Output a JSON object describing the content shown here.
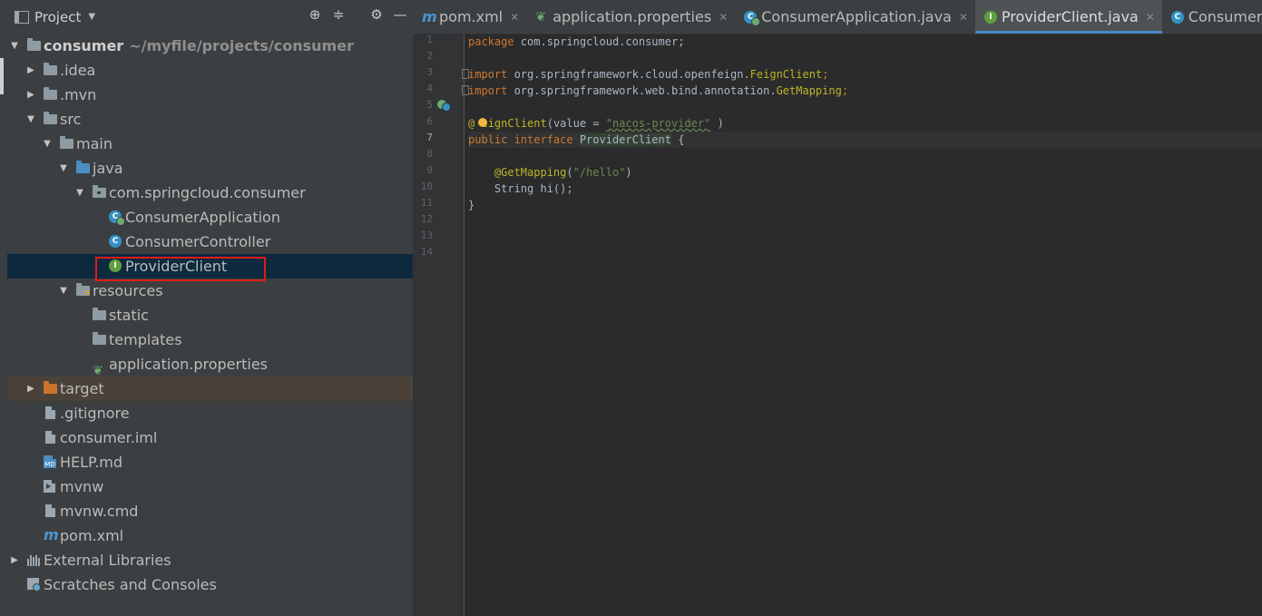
{
  "project_panel": {
    "title": "Project",
    "tree": [
      {
        "id": "root",
        "label": "consumer",
        "path": "~/myfile/projects/consumer"
      },
      {
        "id": "idea",
        "label": ".idea"
      },
      {
        "id": "mvn",
        "label": ".mvn"
      },
      {
        "id": "src",
        "label": "src"
      },
      {
        "id": "main",
        "label": "main"
      },
      {
        "id": "java",
        "label": "java"
      },
      {
        "id": "pkg",
        "label": "com.springcloud.consumer"
      },
      {
        "id": "consumer_app",
        "label": "ConsumerApplication"
      },
      {
        "id": "consumer_ctrl",
        "label": "ConsumerController"
      },
      {
        "id": "provider_client",
        "label": "ProviderClient"
      },
      {
        "id": "resources",
        "label": "resources"
      },
      {
        "id": "static",
        "label": "static"
      },
      {
        "id": "templates",
        "label": "templates"
      },
      {
        "id": "app_props",
        "label": "application.properties"
      },
      {
        "id": "target",
        "label": "target"
      },
      {
        "id": "gitignore",
        "label": ".gitignore"
      },
      {
        "id": "consumer_iml",
        "label": "consumer.iml"
      },
      {
        "id": "help_md",
        "label": "HELP.md"
      },
      {
        "id": "mvnw",
        "label": "mvnw"
      },
      {
        "id": "mvnw_cmd",
        "label": "mvnw.cmd"
      },
      {
        "id": "pom",
        "label": "pom.xml"
      },
      {
        "id": "ext_libs",
        "label": "External Libraries"
      },
      {
        "id": "scratches",
        "label": "Scratches and Consoles"
      }
    ]
  },
  "editor": {
    "tabs": [
      {
        "label": "pom.xml",
        "icon": "maven-icon"
      },
      {
        "label": "application.properties",
        "icon": "spring-properties-icon"
      },
      {
        "label": "ConsumerApplication.java",
        "icon": "spring-class-icon"
      },
      {
        "label": "ProviderClient.java",
        "icon": "interface-icon",
        "active": true
      },
      {
        "label": "ConsumerController.java",
        "icon": "class-icon"
      }
    ],
    "line_numbers": [
      "1",
      "2",
      "3",
      "4",
      "5",
      "6",
      "7",
      "8",
      "9",
      "10",
      "11",
      "12",
      "13",
      "14"
    ],
    "code": {
      "l1_kw": "package",
      "l1_rest": " com.springcloud.consumer;",
      "l3_kw": "import",
      "l3_a": " org.springframework.cloud.openfeign.",
      "l3_cls": "FeignClient",
      "l3_semi": ";",
      "l4_kw": "import",
      "l4_a": " org.springframework.web.bind.annotation.",
      "l4_cls": "GetMapping",
      "l4_semi": ";",
      "l6_at": "@",
      "l6_ann_gap": "F",
      "l6_ann": "eignClient",
      "l6_a": "(value = ",
      "l6_str": "\"nacos-provider\"",
      "l6_b": " )",
      "l7_kw": "public interface",
      "l7_sp": " ",
      "l7_name": "ProviderClient",
      "l7_b": " {",
      "l9_indent": "    ",
      "l9_ann": "@GetMapping",
      "l9_a": "(",
      "l9_str": "\"/hello\"",
      "l9_b": ")",
      "l10": "    String hi();",
      "l11": "}"
    }
  },
  "colors": {
    "selection": "#0d293e",
    "highlight_box": "#e01b1b",
    "active_tab_underline": "#4a88c7"
  }
}
